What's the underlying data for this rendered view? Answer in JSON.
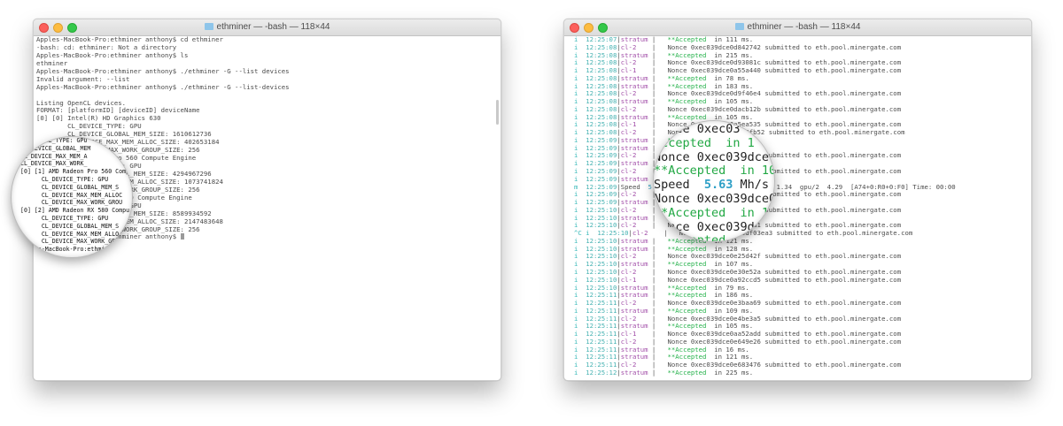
{
  "left_window": {
    "title": "ethminer — -bash — 118×44",
    "lines": [
      "Apples-MacBook-Pro:ethminer anthony$ cd ethminer",
      "-bash: cd: ethminer: Not a directory",
      "Apples-MacBook-Pro:ethminer anthony$ ls",
      "ethminer",
      "Apples-MacBook-Pro:ethminer anthony$ ./ethminer -G --list devices",
      "Invalid argument: --list",
      "Apples-MacBook-Pro:ethminer anthony$ ./ethminer -G --list-devices",
      "",
      "Listing OpenCL devices.",
      "FORMAT: [platformID] [deviceID] deviceName",
      "[0] [0] Intel(R) HD Graphics 630",
      "        CL_DEVICE_TYPE: GPU",
      "        CL_DEVICE_GLOBAL_MEM_SIZE: 1610612736",
      "        CL_DEVICE_MAX_MEM_ALLOC_SIZE: 402653184",
      "        CL_DEVICE_MAX_WORK_GROUP_SIZE: 256",
      "[0] [1] AMD Radeon Pro 560 Compute Engine",
      "        CL_DEVICE_TYPE: GPU",
      "        CL_DEVICE_GLOBAL_MEM_SIZE: 4294967296",
      "        CL_DEVICE_MAX_MEM_ALLOC_SIZE: 1073741824",
      "        CL_DEVICE_MAX_WORK_GROUP_SIZE: 256",
      "[0] [2] AMD Radeon RX 580 Compute Engine",
      "        CL_DEVICE_TYPE: GPU",
      "        CL_DEVICE_GLOBAL_MEM_SIZE: 8589934592",
      "        CL_DEVICE_MAX_MEM_ALLOC_SIZE: 2147483648",
      "        CL_DEVICE_MAX_WORK_GROUP_SIZE: 256",
      "Apples-MacBook-Pro:ethminer anthony$ "
    ],
    "magnifier_lines": [
      "CL_DEVICE_TYPE: GPU",
      "CL_DEVICE_GLOBAL_MEM",
      "CL_DEVICE_MAX_MEM_A",
      "CL_DEVICE_MAX_WORK_",
      "[0] [1] AMD Radeon Pro 560 Comp",
      "      CL_DEVICE_TYPE: GPU",
      "      CL_DEVICE_GLOBAL_MEM_S",
      "      CL_DEVICE_MAX_MEM_ALLOC",
      "      CL_DEVICE_MAX_WORK_GROU",
      "[0] [2] AMD Radeon RX 580 Compu",
      "      CL_DEVICE_TYPE: GPU",
      "      CL_DEVICE_GLOBAL_MEM_S",
      "      CL_DEVICE_MAX_MEM_ALLO",
      "      CL_DEVICE_MAX_WORK_GR",
      "Apples-MacBook-Pro:ethminer"
    ]
  },
  "right_window": {
    "title": "ethminer — -bash — 118×44",
    "rows": [
      {
        "m": "i",
        "t": "12:25:07",
        "s": "stratum",
        "k": "acc",
        "x": "in 111 ms."
      },
      {
        "m": "i",
        "t": "12:25:08",
        "s": "cl-2",
        "k": "non",
        "x": "Nonce 0xec039dce0d842742 submitted to eth.pool.minergate.com"
      },
      {
        "m": "i",
        "t": "12:25:08",
        "s": "stratum",
        "k": "acc",
        "x": "in 215 ms."
      },
      {
        "m": "i",
        "t": "12:25:08",
        "s": "cl-2",
        "k": "non",
        "x": "Nonce 0xec039dce0d93081c submitted to eth.pool.minergate.com"
      },
      {
        "m": "i",
        "t": "12:25:08",
        "s": "cl-1",
        "k": "non",
        "x": "Nonce 0xec039dce0a55a440 submitted to eth.pool.minergate.com"
      },
      {
        "m": "i",
        "t": "12:25:08",
        "s": "stratum",
        "k": "acc",
        "x": "in 78 ms."
      },
      {
        "m": "i",
        "t": "12:25:08",
        "s": "stratum",
        "k": "acc",
        "x": "in 183 ms."
      },
      {
        "m": "i",
        "t": "12:25:08",
        "s": "cl-2",
        "k": "non",
        "x": "Nonce 0xec039dce0d9f46e4 submitted to eth.pool.minergate.com"
      },
      {
        "m": "i",
        "t": "12:25:08",
        "s": "stratum",
        "k": "acc",
        "x": "in 105 ms."
      },
      {
        "m": "i",
        "t": "12:25:08",
        "s": "cl-2",
        "k": "non",
        "x": "Nonce 0xec039dce0dacb12b submitted to eth.pool.minergate.com"
      },
      {
        "m": "i",
        "t": "12:25:08",
        "s": "stratum",
        "k": "acc",
        "x": "in 105 ms."
      },
      {
        "m": "i",
        "t": "12:25:08",
        "s": "cl-1",
        "k": "non",
        "x": "Nonce 0xec039dce0a5ea535 submitted to eth.pool.minergate.com"
      },
      {
        "m": "i",
        "t": "12:25:08",
        "s": "cl-2",
        "k": "non",
        "x": "Nonce 0xec039dce0dbc6fb52 submitted to eth.pool.minergate.com"
      },
      {
        "m": "i",
        "t": "12:25:09",
        "s": "stratum",
        "k": "acc",
        "x": "in 154 ms."
      },
      {
        "m": "i",
        "t": "12:25:09",
        "s": "stratum",
        "k": "acc",
        "x": "in 147 ms."
      },
      {
        "m": "i",
        "t": "12:25:09",
        "s": "cl-2",
        "k": "non",
        "x": "Nonce 0xec039dce0dc7e0f3 submitted to eth.pool.minergate.com"
      },
      {
        "m": "i",
        "t": "12:25:09",
        "s": "stratum",
        "k": "acc",
        "x": "in 108 ms."
      },
      {
        "m": "i",
        "t": "12:25:09",
        "s": "cl-2",
        "k": "non",
        "x": "Nonce 0xec039dce0dcf9bd1 submitted to eth.pool.minergate.com"
      },
      {
        "m": "i",
        "t": "12:25:09",
        "s": "stratum",
        "k": "acc",
        "x": "in 102 ms."
      },
      {
        "m": "m",
        "t": "12:25:09",
        "s": "",
        "k": "speed",
        "v": "5.63",
        "x1": "Mh/s    gpu/0  0.00  gpu/1  1.34  gpu/2  4.29  [A74+0:R0+0:F0] Time: 00:00"
      },
      {
        "m": "i",
        "t": "12:25:09",
        "s": "cl-2",
        "k": "non",
        "x": "Nonce 0xec039dce0dd8e84d submitted to eth.pool.minergate.com"
      },
      {
        "m": "i",
        "t": "12:25:09",
        "s": "stratum",
        "k": "acc",
        "x": "in 110 ms."
      },
      {
        "m": "i",
        "t": "12:25:10",
        "s": "cl-2",
        "k": "non",
        "x": "Nonce 0xec039dce0de1a06c submitted to eth.pool.minergate.com"
      },
      {
        "m": "i",
        "t": "12:25:10",
        "s": "stratum",
        "k": "acc",
        "x": "in 118 ms."
      },
      {
        "m": "i",
        "t": "12:25:10",
        "s": "cl-2",
        "k": "non",
        "x": "Nonce 0xec039dce0de9b7a1 submitted to eth.pool.minergate.com"
      },
      {
        "m": "^C i",
        "t": "12:25:10",
        "s": "cl-2",
        "k": "non",
        "x": "Nonce 0xec039dce0df03ea3 submitted to eth.pool.minergate.com"
      },
      {
        "m": "i",
        "t": "12:25:10",
        "s": "stratum",
        "k": "acc",
        "x": "in 121 ms."
      },
      {
        "m": "i",
        "t": "12:25:10",
        "s": "stratum",
        "k": "acc",
        "x": "in 128 ms."
      },
      {
        "m": "i",
        "t": "12:25:10",
        "s": "cl-2",
        "k": "non",
        "x": "Nonce 0xec039dce0e25d42f submitted to eth.pool.minergate.com"
      },
      {
        "m": "i",
        "t": "12:25:10",
        "s": "stratum",
        "k": "acc",
        "x": "in 107 ms."
      },
      {
        "m": "i",
        "t": "12:25:10",
        "s": "cl-2",
        "k": "non",
        "x": "Nonce 0xec039dce0e30e52a submitted to eth.pool.minergate.com"
      },
      {
        "m": "i",
        "t": "12:25:10",
        "s": "cl-1",
        "k": "non",
        "x": "Nonce 0xec039dce0a92ccd5 submitted to eth.pool.minergate.com"
      },
      {
        "m": "i",
        "t": "12:25:10",
        "s": "stratum",
        "k": "acc",
        "x": "in 79 ms."
      },
      {
        "m": "i",
        "t": "12:25:11",
        "s": "stratum",
        "k": "acc",
        "x": "in 186 ms."
      },
      {
        "m": "i",
        "t": "12:25:11",
        "s": "cl-2",
        "k": "non",
        "x": "Nonce 0xec039dce0e3baa69 submitted to eth.pool.minergate.com"
      },
      {
        "m": "i",
        "t": "12:25:11",
        "s": "stratum",
        "k": "acc",
        "x": "in 109 ms."
      },
      {
        "m": "i",
        "t": "12:25:11",
        "s": "cl-2",
        "k": "non",
        "x": "Nonce 0xec039dce0e4be3a5 submitted to eth.pool.minergate.com"
      },
      {
        "m": "i",
        "t": "12:25:11",
        "s": "stratum",
        "k": "acc",
        "x": "in 105 ms."
      },
      {
        "m": "i",
        "t": "12:25:11",
        "s": "cl-1",
        "k": "non",
        "x": "Nonce 0xec039dce0aa52add submitted to eth.pool.minergate.com"
      },
      {
        "m": "i",
        "t": "12:25:11",
        "s": "cl-2",
        "k": "non",
        "x": "Nonce 0xec039dce0e649e26 submitted to eth.pool.minergate.com"
      },
      {
        "m": "i",
        "t": "12:25:11",
        "s": "stratum",
        "k": "acc",
        "x": "in 16 ms."
      },
      {
        "m": "i",
        "t": "12:25:11",
        "s": "stratum",
        "k": "acc",
        "x": "in 121 ms."
      },
      {
        "m": "i",
        "t": "12:25:11",
        "s": "cl-2",
        "k": "non",
        "x": "Nonce 0xec039dce0e683476 submitted to eth.pool.minergate.com"
      },
      {
        "m": "i",
        "t": "12:25:12",
        "s": "stratum",
        "k": "acc",
        "x": "in 225 ms."
      }
    ],
    "accepted_label": "**Accepted",
    "speed_label": "Speed",
    "magnifier": [
      {
        "k": "tx",
        "a": "Nonce 0xec03"
      },
      {
        "k": "gr",
        "a": "Accepted  in 1"
      },
      {
        "k": "tx",
        "a": "Nonce 0xec039dce0"
      },
      {
        "k": "gr",
        "a": "**Accepted  in 10"
      },
      {
        "k": "speed",
        "a": "Speed  ",
        "b": "5.63",
        "c": " Mh/s"
      },
      {
        "k": "tx",
        "a": "Nonce 0xec039dce0"
      },
      {
        "k": "gr",
        "a": "**Accepted  in 11"
      },
      {
        "k": "tx",
        "a": "Nonce 0xec039dc"
      },
      {
        "k": "gr",
        "a": "**Accepted"
      }
    ]
  },
  "colors": {
    "accepted": "#24b14a",
    "source": "#a24fa9",
    "time": "#46b2b2",
    "speed": "#3aa6c6",
    "text": "#4d4d4d"
  }
}
